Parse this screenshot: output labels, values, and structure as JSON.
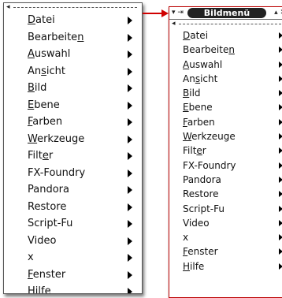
{
  "left_menu": {
    "tearoff_arrow": "◂",
    "items": [
      {
        "pre": "",
        "mn": "D",
        "post": "atei"
      },
      {
        "pre": "Bearbeite",
        "mn": "n",
        "post": ""
      },
      {
        "pre": "",
        "mn": "A",
        "post": "uswahl"
      },
      {
        "pre": "An",
        "mn": "s",
        "post": "icht"
      },
      {
        "pre": "",
        "mn": "B",
        "post": "ild"
      },
      {
        "pre": "",
        "mn": "E",
        "post": "bene"
      },
      {
        "pre": "",
        "mn": "F",
        "post": "arben"
      },
      {
        "pre": "",
        "mn": "W",
        "post": "erkzeuge"
      },
      {
        "pre": "Filt",
        "mn": "e",
        "post": "r"
      },
      {
        "pre": "FX-Foundry",
        "mn": "",
        "post": ""
      },
      {
        "pre": "Pandora",
        "mn": "",
        "post": ""
      },
      {
        "pre": "Restore",
        "mn": "",
        "post": ""
      },
      {
        "pre": "Script-Fu",
        "mn": "",
        "post": ""
      },
      {
        "pre": "Video",
        "mn": "",
        "post": ""
      },
      {
        "pre": "x",
        "mn": "",
        "post": ""
      },
      {
        "pre": "",
        "mn": "F",
        "post": "enster"
      },
      {
        "pre": "",
        "mn": "H",
        "post": "ilfe"
      }
    ]
  },
  "right_window": {
    "title": "Bildmenü",
    "left_buttons": "▾ ⇥",
    "right_buttons": "▴ ✕",
    "tearoff_arrow": "◂"
  },
  "colors": {
    "connector": "#d00000",
    "title_pill": "#222222"
  }
}
